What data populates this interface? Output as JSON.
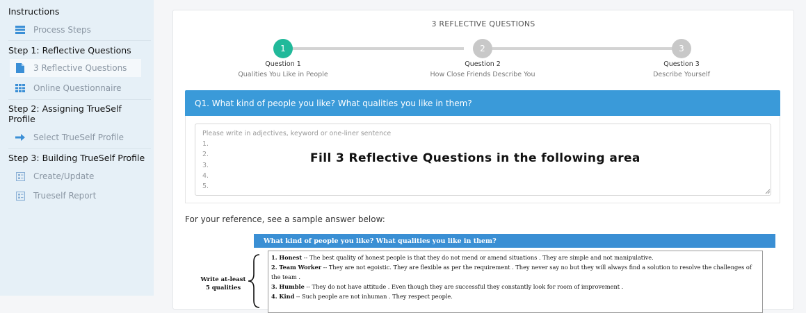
{
  "sidebar": {
    "instructions": "Instructions",
    "process_steps": "Process Steps",
    "step1": "Step 1: Reflective Questions",
    "reflective_questions": "3 Reflective Questions",
    "online_questionnaire": "Online Questionnaire",
    "step2": "Step 2: Assigning TrueSelf Profile",
    "select_profile": "Select TrueSelf Profile",
    "step3": "Step 3: Building TrueSelf Profile",
    "create_update": "Create/Update",
    "trueself_report": "Trueself Report"
  },
  "card": {
    "title": "3 REFLECTIVE QUESTIONS",
    "steps": [
      {
        "number": "1",
        "title": "Question 1",
        "subtitle": "Qualities You Like in People"
      },
      {
        "number": "2",
        "title": "Question 2",
        "subtitle": "How Close Friends Describe You"
      },
      {
        "number": "3",
        "title": "Question 3",
        "subtitle": "Describe Yourself"
      }
    ],
    "question": "Q1. What kind of people you like? What qualities you like in them?",
    "placeholder": "Please write in adjectives, keyword or one-liner sentence\n1.\n2.\n3.\n4.\n5.",
    "overlay_text": "Fill 3 Reflective Questions in the following area",
    "reference": "For your reference, see a sample answer below:"
  },
  "sample": {
    "header": "What kind of people you like? What qualities you like in them?",
    "write_label_line1": "Write at-least",
    "write_label_line2": "5 qualities",
    "items": [
      {
        "name": "1. Honest",
        "text": " -- The best quality of honest people is that they do not mend or amend situations . They are simple and not manipulative."
      },
      {
        "name": "2. Team Worker",
        "text": " -- They are not egoistic. They are flexible as per the requirement . They never say no but they will always find a solution to resolve the challenges of the team ."
      },
      {
        "name": "3. Humble",
        "text": " -- They do not have attitude . Even though they are successful they constantly look for room of improvement ."
      },
      {
        "name": "4. Kind",
        "text": " -- Such people are not inhuman . They respect people."
      }
    ]
  },
  "colors": {
    "accent_blue": "#3a9ad9",
    "active_step": "#21b99a",
    "inactive_step": "#c8c8c8",
    "sidebar_bg": "#e6f0f7",
    "sidebar_icon": "#3b8fd6"
  },
  "icons": {
    "process_steps": "list-icon",
    "reflective_questions": "document-icon",
    "online_questionnaire": "grid-icon",
    "select_profile": "arrow-right-icon",
    "create_update": "form-icon",
    "trueself_report": "form-icon"
  }
}
